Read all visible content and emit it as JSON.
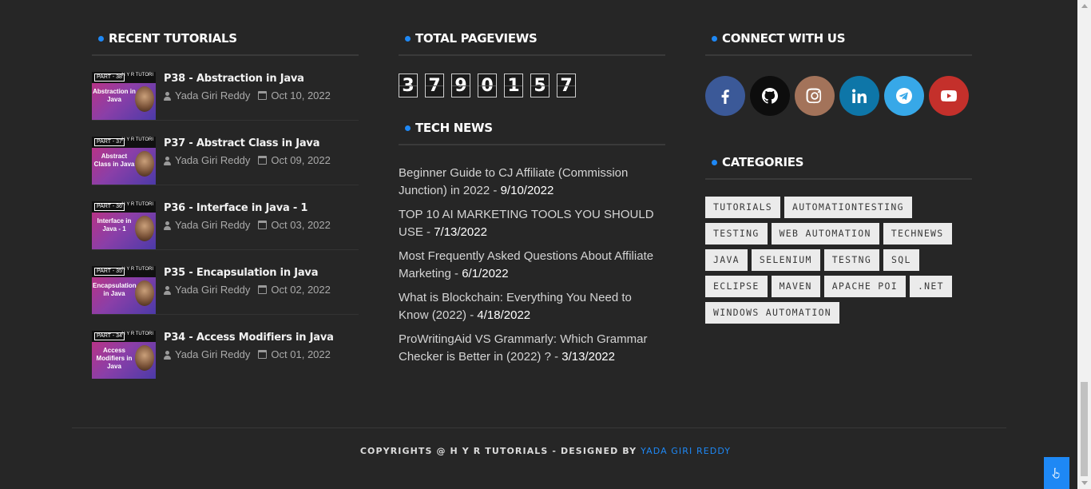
{
  "recent": {
    "title": "RECENT TUTORIALS",
    "posts": [
      {
        "title": "P38 - Abstraction in Java",
        "author": "Yada Giri Reddy",
        "date": "Oct 10, 2022",
        "thumb_part": "PART - 38",
        "thumb_text": "Abstraction in Java",
        "thumb_brand": "H Y R TUTORI"
      },
      {
        "title": "P37 - Abstract Class in Java",
        "author": "Yada Giri Reddy",
        "date": "Oct 09, 2022",
        "thumb_part": "PART - 37",
        "thumb_text": "Abstract Class in Java",
        "thumb_brand": "H Y R TUTORI"
      },
      {
        "title": "P36 - Interface in Java - 1",
        "author": "Yada Giri Reddy",
        "date": "Oct 03, 2022",
        "thumb_part": "PART - 36",
        "thumb_text": "Interface in Java - 1",
        "thumb_brand": "H Y R TUTORI"
      },
      {
        "title": "P35 - Encapsulation in Java",
        "author": "Yada Giri Reddy",
        "date": "Oct 02, 2022",
        "thumb_part": "PART - 35",
        "thumb_text": "Encapsulation in Java",
        "thumb_brand": "H Y R TUTORI"
      },
      {
        "title": "P34 - Access Modifiers in Java",
        "author": "Yada Giri Reddy",
        "date": "Oct 01, 2022",
        "thumb_part": "PART - 34",
        "thumb_text": "Access Modifiers in Java",
        "thumb_brand": "H Y R TUTORI"
      }
    ]
  },
  "pageviews": {
    "title": "TOTAL PAGEVIEWS",
    "digits": [
      "3",
      "7",
      "9",
      "0",
      "1",
      "5",
      "7"
    ]
  },
  "tech_news": {
    "title": "TECH NEWS",
    "items": [
      {
        "text": "Beginner Guide to CJ Affiliate (Commission Junction) in 2022",
        "date": "9/10/2022"
      },
      {
        "text": "TOP 10 AI MARKETING TOOLS YOU SHOULD USE",
        "date": "7/13/2022"
      },
      {
        "text": "Most Frequently Asked Questions About Affiliate Marketing",
        "date": "6/1/2022"
      },
      {
        "text": "What is Blockchain: Everything You Need to Know (2022)",
        "date": "4/18/2022"
      },
      {
        "text": "ProWritingAid VS Grammarly: Which Grammar Checker is Better in (2022) ?",
        "date": "3/13/2022"
      }
    ]
  },
  "connect": {
    "title": "CONNECT WITH US",
    "networks": [
      {
        "name": "facebook",
        "color": "#3b5998"
      },
      {
        "name": "github",
        "color": "#0d0d0d"
      },
      {
        "name": "instagram",
        "color": "#a3735a"
      },
      {
        "name": "linkedin",
        "color": "#0e76a8"
      },
      {
        "name": "telegram",
        "color": "#37a8e8"
      },
      {
        "name": "youtube",
        "color": "#c4302b"
      }
    ]
  },
  "categories": {
    "title": "CATEGORIES",
    "tags": [
      "TUTORIALS",
      "AUTOMATIONTESTING",
      "TESTING",
      "WEB AUTOMATION",
      "TECHNEWS",
      "JAVA",
      "SELENIUM",
      "TESTNG",
      "SQL",
      "ECLIPSE",
      "MAVEN",
      "APACHE POI",
      ".NET",
      "WINDOWS AUTOMATION"
    ]
  },
  "footer": {
    "copyright": "COPYRIGHTS @ H Y R TUTORIALS - DESIGNED BY ",
    "designer": "YADA GIRI REDDY"
  },
  "accent_color": "#1e88f5"
}
